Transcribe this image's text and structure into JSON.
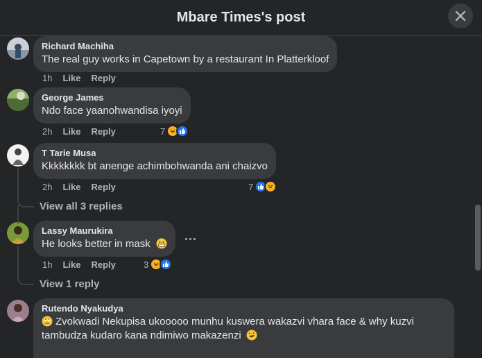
{
  "header": {
    "title": "Mbare Times's post"
  },
  "comments": [
    {
      "author": "Richard Machiha",
      "text": "The real guy works in Capetown by a restaurant In Platterkloof",
      "time": "1h",
      "like": "Like",
      "reply": "Reply"
    },
    {
      "author": "George James",
      "text": "Ndo face yaanohwandisa iyoyi",
      "time": "2h",
      "like": "Like",
      "reply": "Reply",
      "reactions": {
        "count": "7",
        "icons": [
          "haha",
          "like"
        ]
      }
    },
    {
      "author": "T Tarie Musa",
      "text": "Kkkkkkkk bt anenge achimbohwanda ani chaizvo",
      "time": "2h",
      "like": "Like",
      "reply": "Reply",
      "reactions": {
        "count": "7",
        "icons": [
          "like",
          "haha"
        ]
      },
      "view_replies": "View all 3 replies"
    },
    {
      "author": "Lassy Maurukira",
      "text": "He looks better in mask",
      "emoji": "grimacing",
      "time": "1h",
      "like": "Like",
      "reply": "Reply",
      "reactions": {
        "count": "3",
        "icons": [
          "haha",
          "like"
        ]
      },
      "view_replies": "View 1 reply"
    },
    {
      "author": "Rutendo Nyakudya",
      "text_line1": "Zvokwadi Nekupisa ukooooo munhu kuswera wakazvi vhara face & why kuzvi",
      "text_line2": "tambudza kudaro kana ndimiwo makazenzi"
    }
  ]
}
